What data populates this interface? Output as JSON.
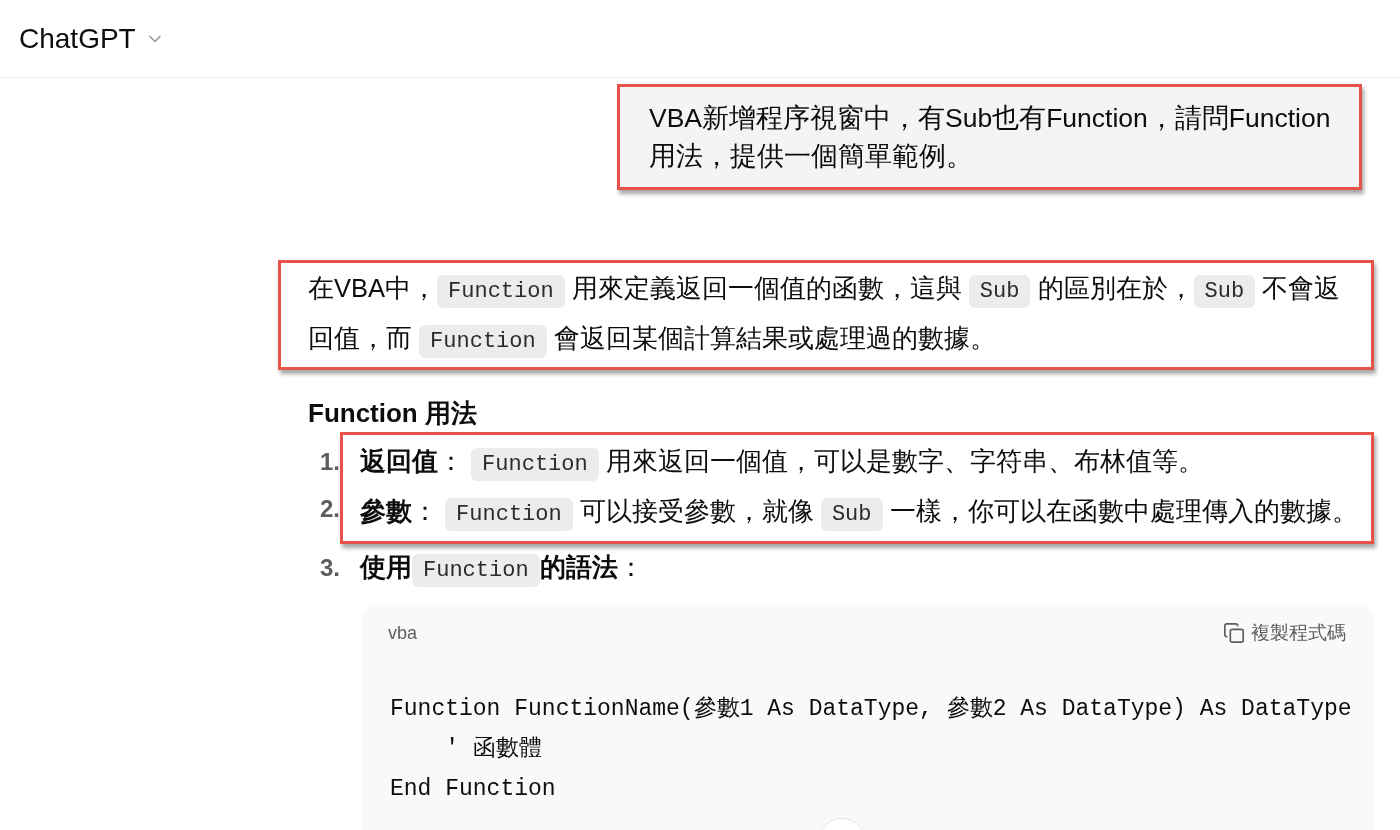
{
  "header": {
    "model": "ChatGPT"
  },
  "user_message": {
    "text": "VBA新增程序視窗中，有Sub也有Function，請問Function用法，提供一個簡單範例。",
    "highlighted": true
  },
  "answer": {
    "intro": {
      "highlighted": true,
      "segments": [
        {
          "kind": "text",
          "text": "在VBA中，"
        },
        {
          "kind": "code",
          "text": "Function"
        },
        {
          "kind": "text",
          "text": " 用來定義返回一個值的函數，這與 "
        },
        {
          "kind": "code",
          "text": "Sub"
        },
        {
          "kind": "text",
          "text": " 的區別在於，"
        },
        {
          "kind": "code",
          "text": "Sub"
        },
        {
          "kind": "text",
          "text": " 不會返回值，而 "
        },
        {
          "kind": "code",
          "text": "Function"
        },
        {
          "kind": "text",
          "text": " 會返回某個計算結果或處理過的數據。"
        }
      ]
    },
    "heading": "Function 用法",
    "list": [
      {
        "number": "1.",
        "highlighted": true,
        "segments": [
          {
            "kind": "strong",
            "text": "返回值"
          },
          {
            "kind": "text",
            "text": "： "
          },
          {
            "kind": "code",
            "text": "Function"
          },
          {
            "kind": "text",
            "text": " 用來返回一個值，可以是數字、字符串、布林值等。"
          }
        ]
      },
      {
        "number": "2.",
        "highlighted": true,
        "segments": [
          {
            "kind": "strong",
            "text": "參數"
          },
          {
            "kind": "text",
            "text": "： "
          },
          {
            "kind": "code",
            "text": "Function"
          },
          {
            "kind": "text",
            "text": " 可以接受參數，就像 "
          },
          {
            "kind": "code",
            "text": "Sub"
          },
          {
            "kind": "text",
            "text": " 一樣，你可以在函數中處理傳入的數據。"
          }
        ]
      },
      {
        "number": "3.",
        "highlighted": false,
        "segments": [
          {
            "kind": "strong",
            "text": "使用"
          },
          {
            "kind": "code",
            "text": "Function"
          },
          {
            "kind": "strong",
            "text": "的語法"
          },
          {
            "kind": "text",
            "text": "："
          }
        ],
        "code_block": {
          "language": "vba",
          "copy_label": "複製程式碼",
          "code": "Function FunctionName(參數1 As DataType, 參數2 As DataType) As DataType\n    ' 函數體\nEnd Function"
        }
      }
    ]
  }
}
